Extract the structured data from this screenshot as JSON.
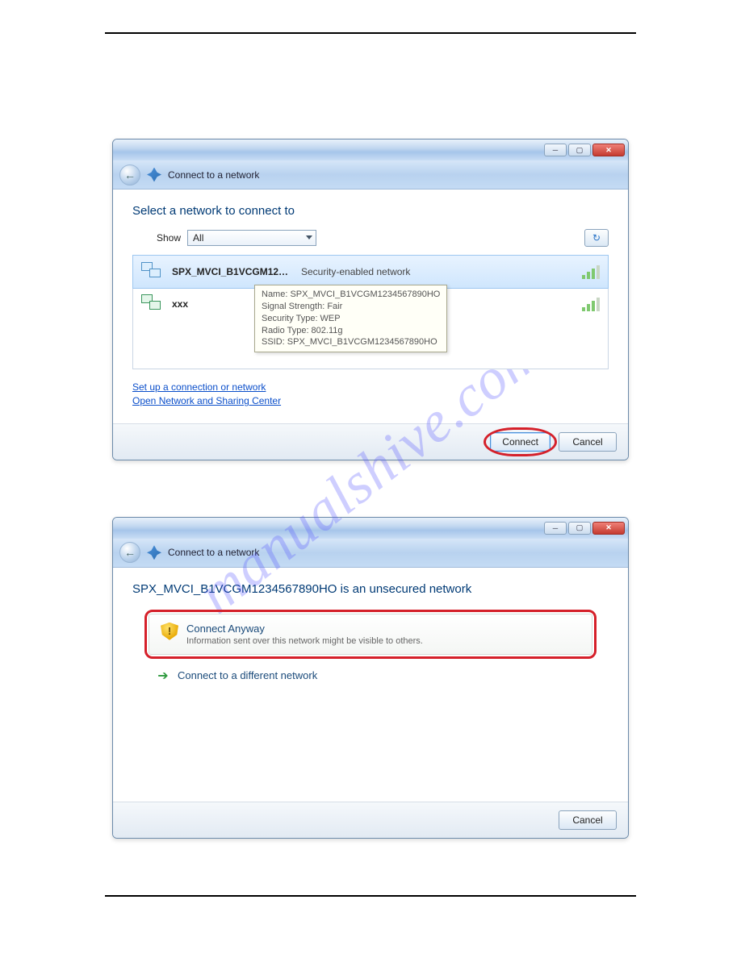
{
  "watermark": "manualshive.com",
  "window1": {
    "nav_title": "Connect to a network",
    "heading": "Select a network to connect to",
    "show_label": "Show",
    "show_value": "All",
    "networks": [
      {
        "name": "SPX_MVCI_B1VCGM12…",
        "desc": "Security-enabled network"
      },
      {
        "name": "xxx",
        "desc": ""
      }
    ],
    "tooltip": {
      "l1": "Name: SPX_MVCI_B1VCGM1234567890HO",
      "l2": "Signal Strength: Fair",
      "l3": "Security Type: WEP",
      "l4": "Radio Type: 802.11g",
      "l5": "SSID: SPX_MVCI_B1VCGM1234567890HO"
    },
    "link1": "Set up a connection or network",
    "link2": "Open Network and Sharing Center",
    "connect_btn": "Connect",
    "cancel_btn": "Cancel"
  },
  "window2": {
    "nav_title": "Connect to a network",
    "heading": "SPX_MVCI_B1VCGM1234567890HO is an unsecured network",
    "opt1_title": "Connect Anyway",
    "opt1_sub": "Information sent over this network might be visible to others.",
    "opt2_title": "Connect to a different network",
    "cancel_btn": "Cancel"
  }
}
